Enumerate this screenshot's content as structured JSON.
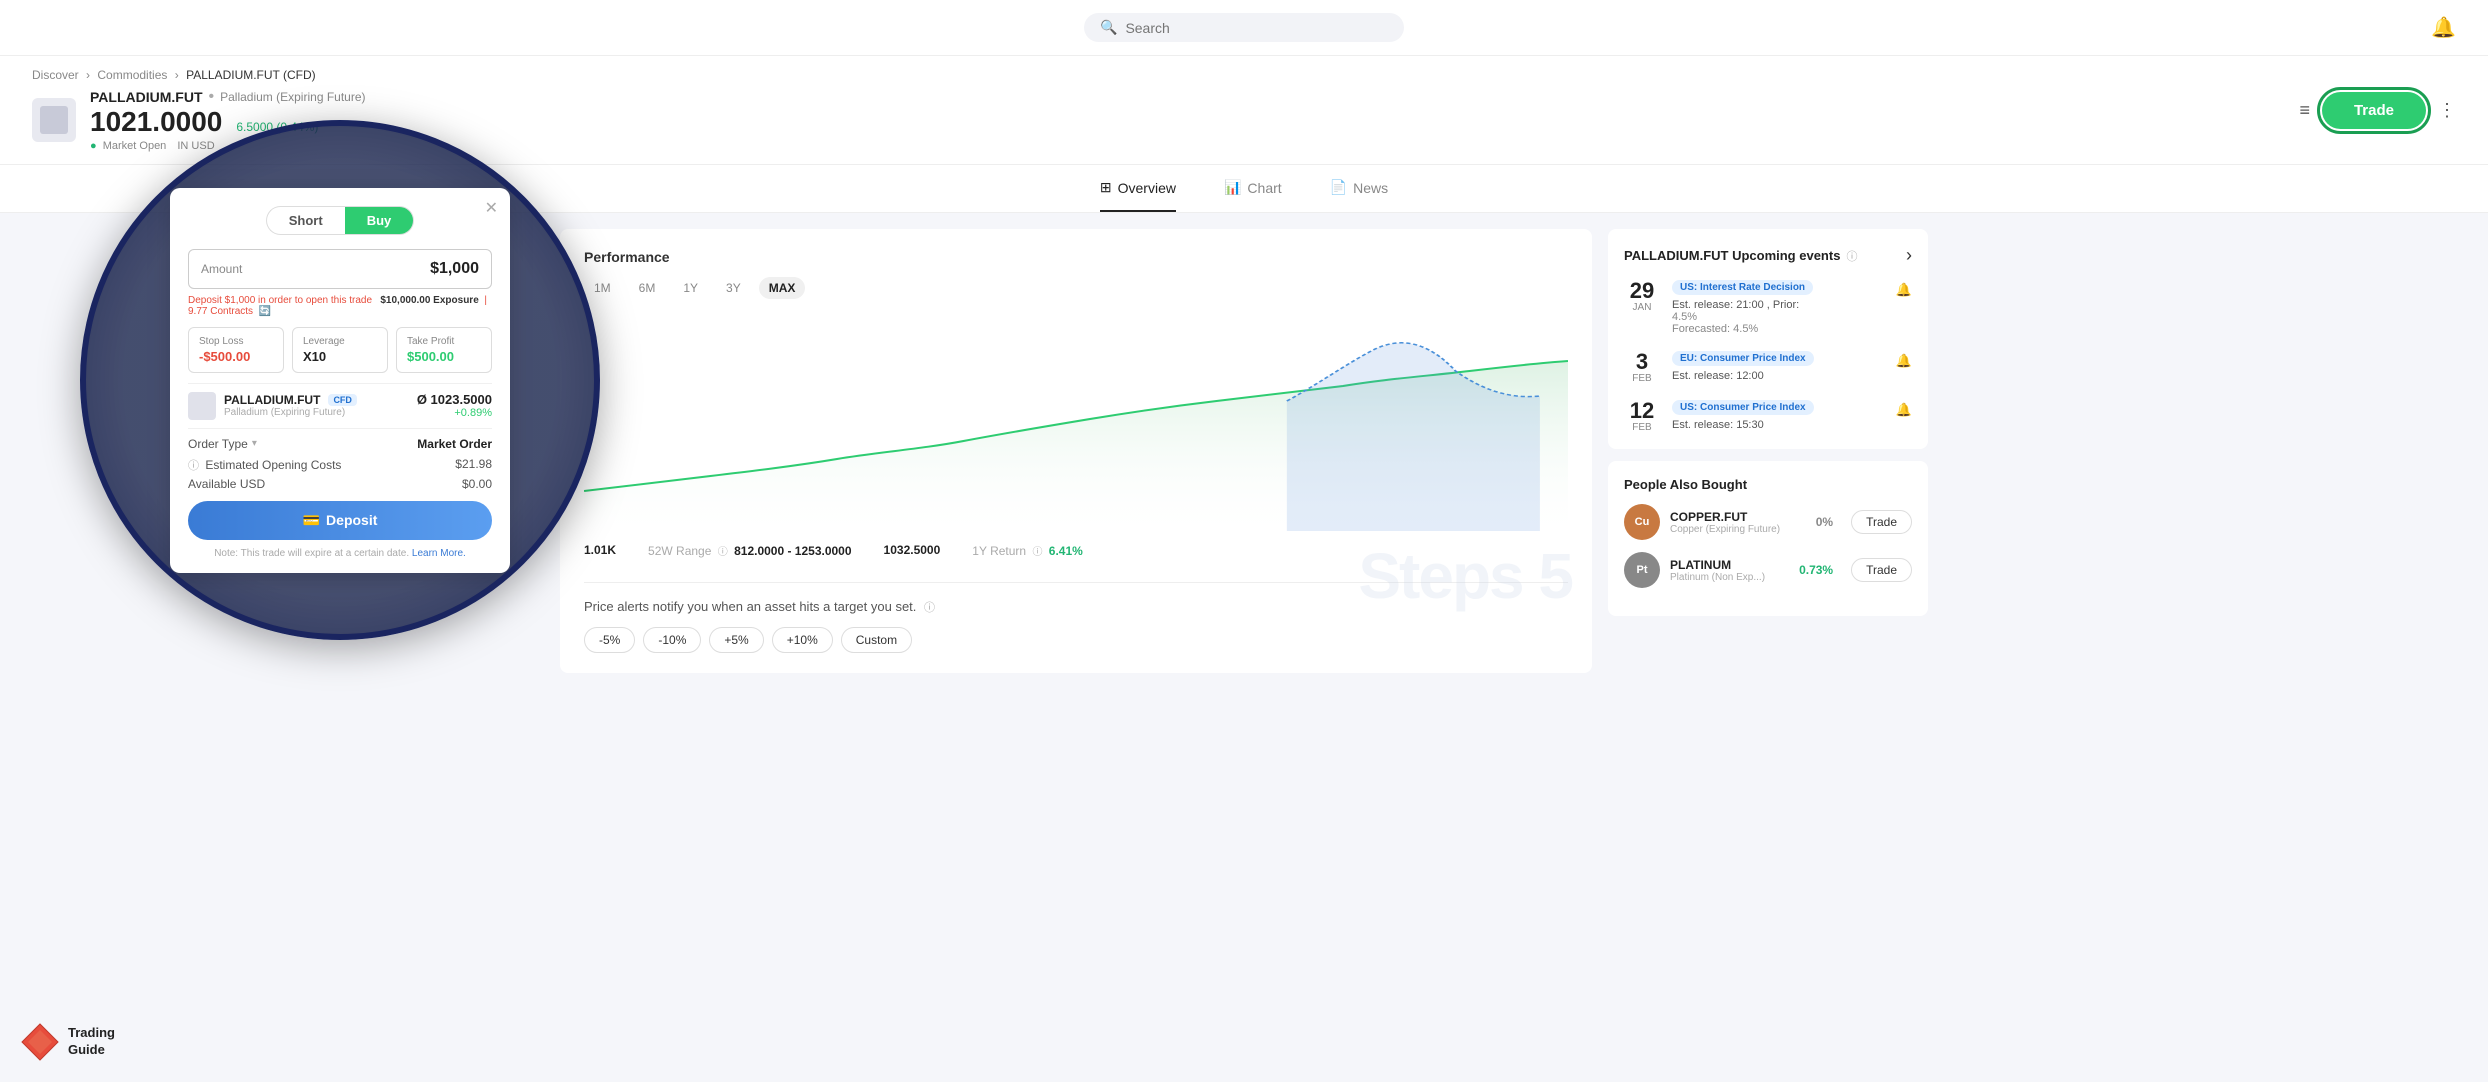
{
  "header": {
    "search_placeholder": "Search",
    "bell_icon": "bell-icon"
  },
  "asset": {
    "ticker": "PALLADIUM.FUT",
    "dot": "•",
    "full_name": "Palladium (Expiring Future)",
    "price": "1021.0000",
    "change": "6.5000 (0.44%)",
    "market_status": "Market Open",
    "currency": "IN USD",
    "breadcrumb": {
      "discover": "Discover",
      "commodities": "Commodities",
      "current": "PALLADIUM.FUT (CFD)"
    }
  },
  "tabs": {
    "overview": "Overview",
    "chart": "Chart",
    "news": "News"
  },
  "chart": {
    "title": "Performance",
    "time_filters": [
      "1M",
      "6M",
      "1Y",
      "3Y",
      "MAX"
    ],
    "active_filter": "MAX",
    "stats": {
      "price_label": "1.01K",
      "week52_label": "52W Range",
      "week52_value": "812.0000 - 1253.0000",
      "price2_label": "1032.5000",
      "return1y_label": "1Y Return",
      "return1y_value": "6.41%"
    }
  },
  "alert_section": {
    "text": "Price alerts notify you when an asset hits a target you set.",
    "buttons": [
      "-5%",
      "-10%",
      "+5%",
      "+10%",
      "Custom"
    ]
  },
  "events": {
    "title": "PALLADIUM.FUT Upcoming events",
    "items": [
      {
        "day": "29",
        "month": "JAN",
        "tag": "US: Interest Rate Decision",
        "tag_color": "blue",
        "est_release": "Est. release: 21:00 , Prior:",
        "prior_value": "4.5%",
        "forecasted": "Forecasted: 4.5%"
      },
      {
        "day": "3",
        "month": "FEB",
        "tag": "EU: Consumer Price Index",
        "tag_color": "blue",
        "est_release": "Est. release: 12:00",
        "prior_value": "",
        "forecasted": ""
      },
      {
        "day": "12",
        "month": "FEB",
        "tag": "US: Consumer Price Index",
        "tag_color": "blue",
        "est_release": "Est. release: 15:30",
        "prior_value": "",
        "forecasted": ""
      }
    ]
  },
  "people_also_bought": {
    "title": "People Also Bought",
    "items": [
      {
        "name": "COPPER.FUT",
        "sub": "Copper (Expiring Future)",
        "change": "0%",
        "change_color": "zero",
        "logo_class": "copper",
        "logo_text": "C"
      },
      {
        "name": "PLATINUM",
        "sub": "Platinum (Non Exp...)",
        "change": "0.73%",
        "change_color": "green",
        "logo_class": "platinum",
        "logo_text": "P"
      }
    ]
  },
  "trade_modal": {
    "short_label": "Short",
    "buy_label": "Buy",
    "amount_label": "Amount",
    "amount_value": "$1,000",
    "deposit_note": "Deposit $1,000 in order to open this trade",
    "exposure": "$10,000.00 Exposure",
    "contracts": "9.77 Contracts",
    "stop_loss_label": "Stop Loss",
    "stop_loss_value": "-$500.00",
    "leverage_label": "Leverage",
    "leverage_value": "X10",
    "take_profit_label": "Take Profit",
    "take_profit_value": "$500.00",
    "asset_name": "PALLADIUM.FUT",
    "asset_badge": "CFD",
    "asset_sub": "Palladium (Expiring Future)",
    "asset_price": "Ø 1023.5000",
    "asset_change": "+0.89%",
    "order_type_label": "Order Type",
    "order_type_caret": "▾",
    "order_type_value": "Market Order",
    "est_opening_label": "Estimated Opening Costs",
    "est_opening_value": "$21.98",
    "available_label": "Available USD",
    "available_value": "$0.00",
    "deposit_btn": "Deposit",
    "note_text": "Note: This trade will expire at a certain date.",
    "learn_more": "Learn More.",
    "close_icon": "✕"
  },
  "toolbar": {
    "trade_label": "Trade",
    "menu_icon": "≡",
    "more_icon": "⋮"
  },
  "tg_logo": {
    "title": "Trading",
    "subtitle": "Guide"
  },
  "watermark": "Steps 5"
}
